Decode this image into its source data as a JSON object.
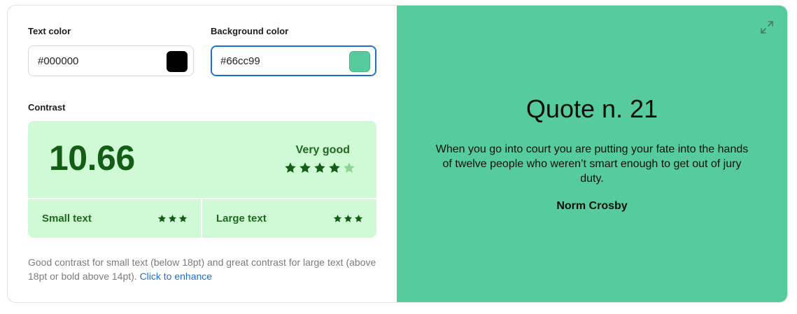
{
  "inputs": {
    "text_color_label": "Text color",
    "text_color_value": "#000000",
    "background_color_label": "Background color",
    "background_color_value": "#66cc99"
  },
  "contrast": {
    "label": "Contrast",
    "ratio": "10.66",
    "rating": "Very good",
    "rating_stars_filled": 4,
    "rating_stars_total": 5,
    "small_text_label": "Small text",
    "small_text_stars": 3,
    "large_text_label": "Large text",
    "large_text_stars": 3,
    "note": "Good contrast for small text (below 18pt) and great contrast for large text (above 18pt or bold above 14pt).",
    "enhance_link": "Click to enhance"
  },
  "preview": {
    "title": "Quote n. 21",
    "quote": "When you go into court you are putting your fate into the hands of twelve people who weren’t smart enough to get out of jury duty.",
    "author": "Norm Crosby",
    "expand_icon": "expand-icon"
  },
  "colors": {
    "preview_background": "#56cc9d",
    "text_swatch": "#000000",
    "background_swatch": "#56cc9d",
    "contrast_panel": "#d0f9d5",
    "star_filled": "#135d16",
    "star_empty": "#8fd496",
    "link": "#1a6fd0"
  }
}
